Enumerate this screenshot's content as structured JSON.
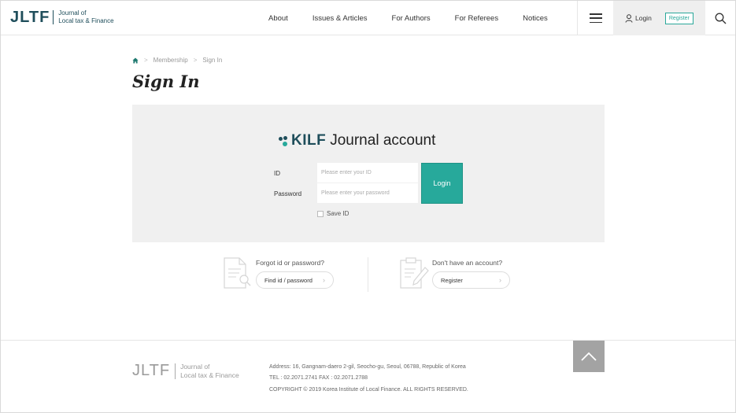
{
  "header": {
    "logo_mark": "JLTF",
    "logo_line1": "Journal of",
    "logo_line2": "Local tax & Finance",
    "nav": [
      "About",
      "Issues & Articles",
      "For Authors",
      "For Referees",
      "Notices"
    ],
    "login_label": "Login",
    "register_label": "Register",
    "icons": {
      "menu": "hamburger-menu-icon",
      "user": "user-icon",
      "search": "search-icon"
    }
  },
  "breadcrumb": {
    "home_icon": "home-icon",
    "items": [
      "Membership",
      "Sign In"
    ]
  },
  "page_title": "Sign In",
  "login_box": {
    "brand_name": "KILF",
    "brand_sub": "Journal account",
    "id_label": "ID",
    "id_placeholder": "Please enter your ID",
    "password_label": "Password",
    "password_placeholder": "Please enter your password",
    "submit_label": "Login",
    "save_id_label": "Save ID"
  },
  "helpers": {
    "find": {
      "title": "Forgot id or password?",
      "button": "Find id / password",
      "icon": "document-search-icon"
    },
    "register": {
      "title": "Don't have an account?",
      "button": "Register",
      "icon": "clipboard-pen-icon"
    }
  },
  "footer": {
    "logo_mark": "JLTF",
    "logo_line1": "Journal of",
    "logo_line2": "Local tax & Finance",
    "address": "Address: 16, Gangnam-daero 2-gil, Seocho-gu, Seoul, 06788, Republic of Korea",
    "contact": "TEL : 02.2071.2741  FAX : 02.2071.2788",
    "copyright": "COPYRIGHT © 2019 Korea Institute of Local Finance. ALL RIGHTS RESERVED.",
    "to_top_icon": "chevron-up-icon"
  },
  "colors": {
    "accent": "#27a99b",
    "brand": "#1f4e5b",
    "panel": "#f0f0f0"
  }
}
